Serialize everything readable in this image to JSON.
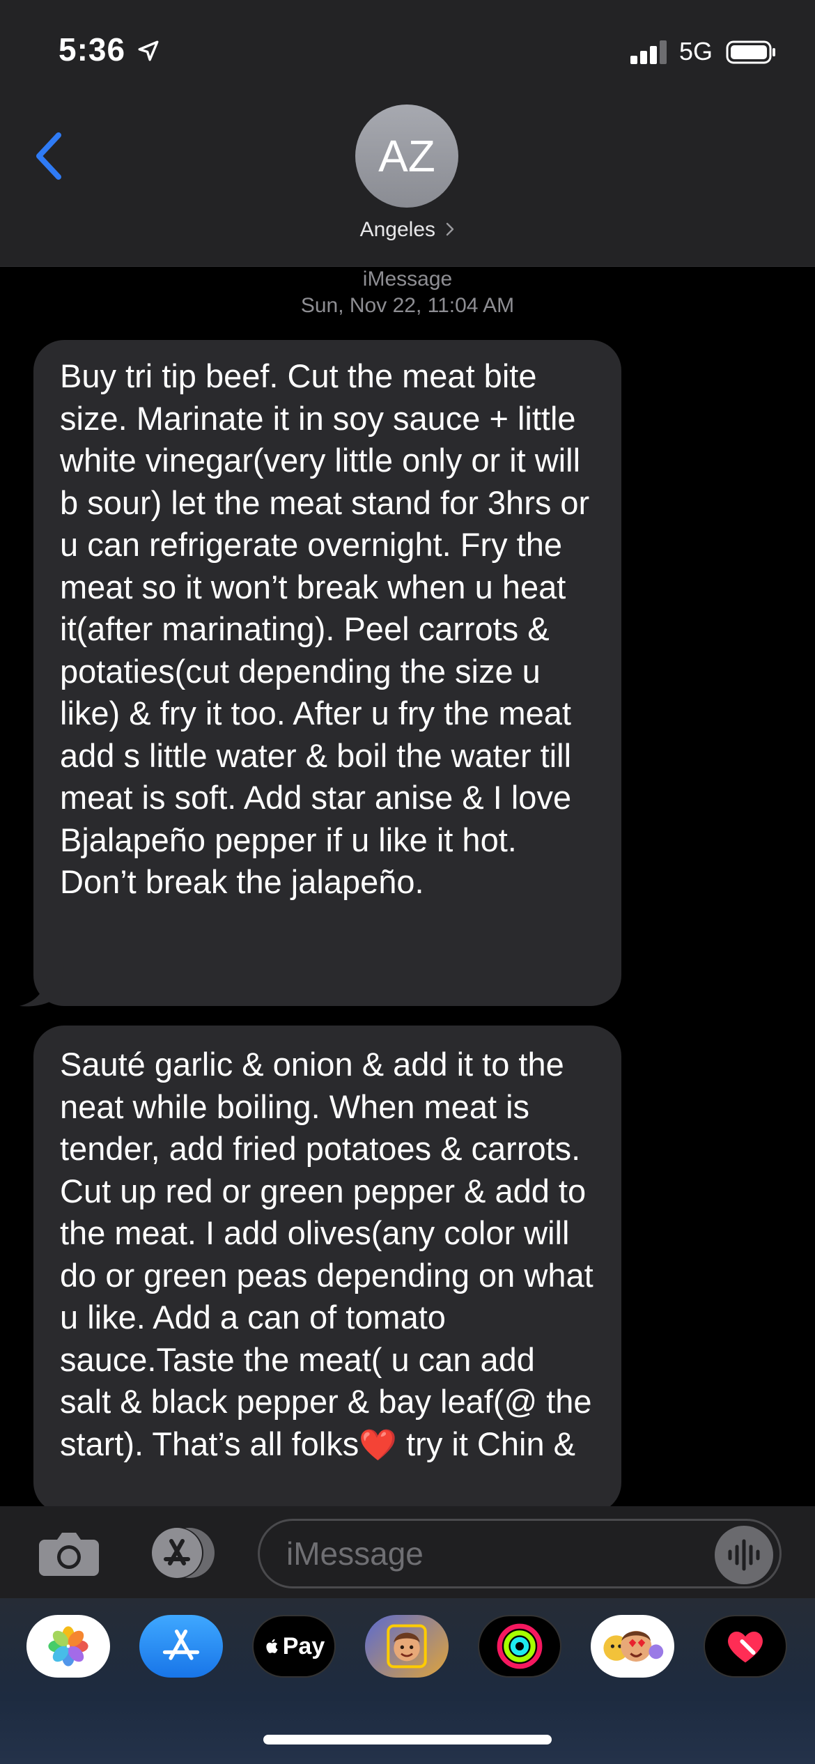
{
  "status_bar": {
    "time": "5:36",
    "network": "5G"
  },
  "contact": {
    "initials": "AZ",
    "name": "Angeles"
  },
  "thread": {
    "service_label": "iMessage",
    "timestamp": "Sun, Nov 22, 11:04 AM",
    "messages": [
      {
        "text": "Buy tri tip beef. Cut the meat bite size. Marinate it in soy sauce + little white vinegar(very little only or it will b sour) let the meat stand for 3hrs or u can refrigerate overnight. Fry the meat so it won’t break when u heat it(after marinating). Peel carrots & potaties(cut depending the size u like) & fry it too. After u fry the meat add s little water & boil the water till meat is soft. Add star anise & I love Bjalapeño pepper if u like it hot. Don’t break the jalapeño."
      },
      {
        "text": "Sauté garlic & onion & add it to the neat while boiling. When meat is tender, add fried potatoes & carrots. Cut up red or green pepper & add to the meat. I add olives(any color will do or green peas depending on what u like. Add a can of tomato sauce.Taste the meat( u can add salt & black pepper & bay leaf(@ the start). That’s all folks",
        "emoji": "❤️",
        "text_after": " try it Chin &"
      }
    ]
  },
  "composer": {
    "placeholder": "iMessage"
  },
  "app_drawer": {
    "apps": [
      {
        "name": "photos-app-icon",
        "label": ""
      },
      {
        "name": "app-store-icon",
        "label": ""
      },
      {
        "name": "apple-pay-icon",
        "label": "Pay"
      },
      {
        "name": "memoji-icon",
        "label": ""
      },
      {
        "name": "activity-icon",
        "label": ""
      },
      {
        "name": "memoji-stickers-icon",
        "label": ""
      },
      {
        "name": "digital-touch-icon",
        "label": ""
      }
    ]
  },
  "colors": {
    "accent": "#2f7bf5",
    "bubble": "#2a2a2d",
    "header": "#232325",
    "heart": "#e02b2b"
  }
}
